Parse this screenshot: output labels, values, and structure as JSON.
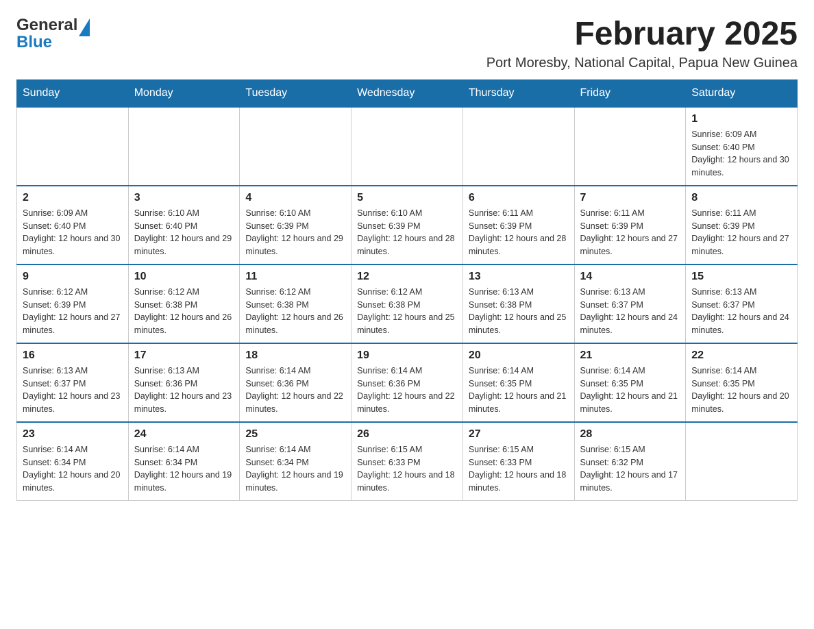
{
  "logo": {
    "general": "General",
    "blue": "Blue"
  },
  "title": "February 2025",
  "subtitle": "Port Moresby, National Capital, Papua New Guinea",
  "headers": [
    "Sunday",
    "Monday",
    "Tuesday",
    "Wednesday",
    "Thursday",
    "Friday",
    "Saturday"
  ],
  "weeks": [
    [
      {
        "day": "",
        "info": ""
      },
      {
        "day": "",
        "info": ""
      },
      {
        "day": "",
        "info": ""
      },
      {
        "day": "",
        "info": ""
      },
      {
        "day": "",
        "info": ""
      },
      {
        "day": "",
        "info": ""
      },
      {
        "day": "1",
        "info": "Sunrise: 6:09 AM\nSunset: 6:40 PM\nDaylight: 12 hours and 30 minutes."
      }
    ],
    [
      {
        "day": "2",
        "info": "Sunrise: 6:09 AM\nSunset: 6:40 PM\nDaylight: 12 hours and 30 minutes."
      },
      {
        "day": "3",
        "info": "Sunrise: 6:10 AM\nSunset: 6:40 PM\nDaylight: 12 hours and 29 minutes."
      },
      {
        "day": "4",
        "info": "Sunrise: 6:10 AM\nSunset: 6:39 PM\nDaylight: 12 hours and 29 minutes."
      },
      {
        "day": "5",
        "info": "Sunrise: 6:10 AM\nSunset: 6:39 PM\nDaylight: 12 hours and 28 minutes."
      },
      {
        "day": "6",
        "info": "Sunrise: 6:11 AM\nSunset: 6:39 PM\nDaylight: 12 hours and 28 minutes."
      },
      {
        "day": "7",
        "info": "Sunrise: 6:11 AM\nSunset: 6:39 PM\nDaylight: 12 hours and 27 minutes."
      },
      {
        "day": "8",
        "info": "Sunrise: 6:11 AM\nSunset: 6:39 PM\nDaylight: 12 hours and 27 minutes."
      }
    ],
    [
      {
        "day": "9",
        "info": "Sunrise: 6:12 AM\nSunset: 6:39 PM\nDaylight: 12 hours and 27 minutes."
      },
      {
        "day": "10",
        "info": "Sunrise: 6:12 AM\nSunset: 6:38 PM\nDaylight: 12 hours and 26 minutes."
      },
      {
        "day": "11",
        "info": "Sunrise: 6:12 AM\nSunset: 6:38 PM\nDaylight: 12 hours and 26 minutes."
      },
      {
        "day": "12",
        "info": "Sunrise: 6:12 AM\nSunset: 6:38 PM\nDaylight: 12 hours and 25 minutes."
      },
      {
        "day": "13",
        "info": "Sunrise: 6:13 AM\nSunset: 6:38 PM\nDaylight: 12 hours and 25 minutes."
      },
      {
        "day": "14",
        "info": "Sunrise: 6:13 AM\nSunset: 6:37 PM\nDaylight: 12 hours and 24 minutes."
      },
      {
        "day": "15",
        "info": "Sunrise: 6:13 AM\nSunset: 6:37 PM\nDaylight: 12 hours and 24 minutes."
      }
    ],
    [
      {
        "day": "16",
        "info": "Sunrise: 6:13 AM\nSunset: 6:37 PM\nDaylight: 12 hours and 23 minutes."
      },
      {
        "day": "17",
        "info": "Sunrise: 6:13 AM\nSunset: 6:36 PM\nDaylight: 12 hours and 23 minutes."
      },
      {
        "day": "18",
        "info": "Sunrise: 6:14 AM\nSunset: 6:36 PM\nDaylight: 12 hours and 22 minutes."
      },
      {
        "day": "19",
        "info": "Sunrise: 6:14 AM\nSunset: 6:36 PM\nDaylight: 12 hours and 22 minutes."
      },
      {
        "day": "20",
        "info": "Sunrise: 6:14 AM\nSunset: 6:35 PM\nDaylight: 12 hours and 21 minutes."
      },
      {
        "day": "21",
        "info": "Sunrise: 6:14 AM\nSunset: 6:35 PM\nDaylight: 12 hours and 21 minutes."
      },
      {
        "day": "22",
        "info": "Sunrise: 6:14 AM\nSunset: 6:35 PM\nDaylight: 12 hours and 20 minutes."
      }
    ],
    [
      {
        "day": "23",
        "info": "Sunrise: 6:14 AM\nSunset: 6:34 PM\nDaylight: 12 hours and 20 minutes."
      },
      {
        "day": "24",
        "info": "Sunrise: 6:14 AM\nSunset: 6:34 PM\nDaylight: 12 hours and 19 minutes."
      },
      {
        "day": "25",
        "info": "Sunrise: 6:14 AM\nSunset: 6:34 PM\nDaylight: 12 hours and 19 minutes."
      },
      {
        "day": "26",
        "info": "Sunrise: 6:15 AM\nSunset: 6:33 PM\nDaylight: 12 hours and 18 minutes."
      },
      {
        "day": "27",
        "info": "Sunrise: 6:15 AM\nSunset: 6:33 PM\nDaylight: 12 hours and 18 minutes."
      },
      {
        "day": "28",
        "info": "Sunrise: 6:15 AM\nSunset: 6:32 PM\nDaylight: 12 hours and 17 minutes."
      },
      {
        "day": "",
        "info": ""
      }
    ]
  ]
}
